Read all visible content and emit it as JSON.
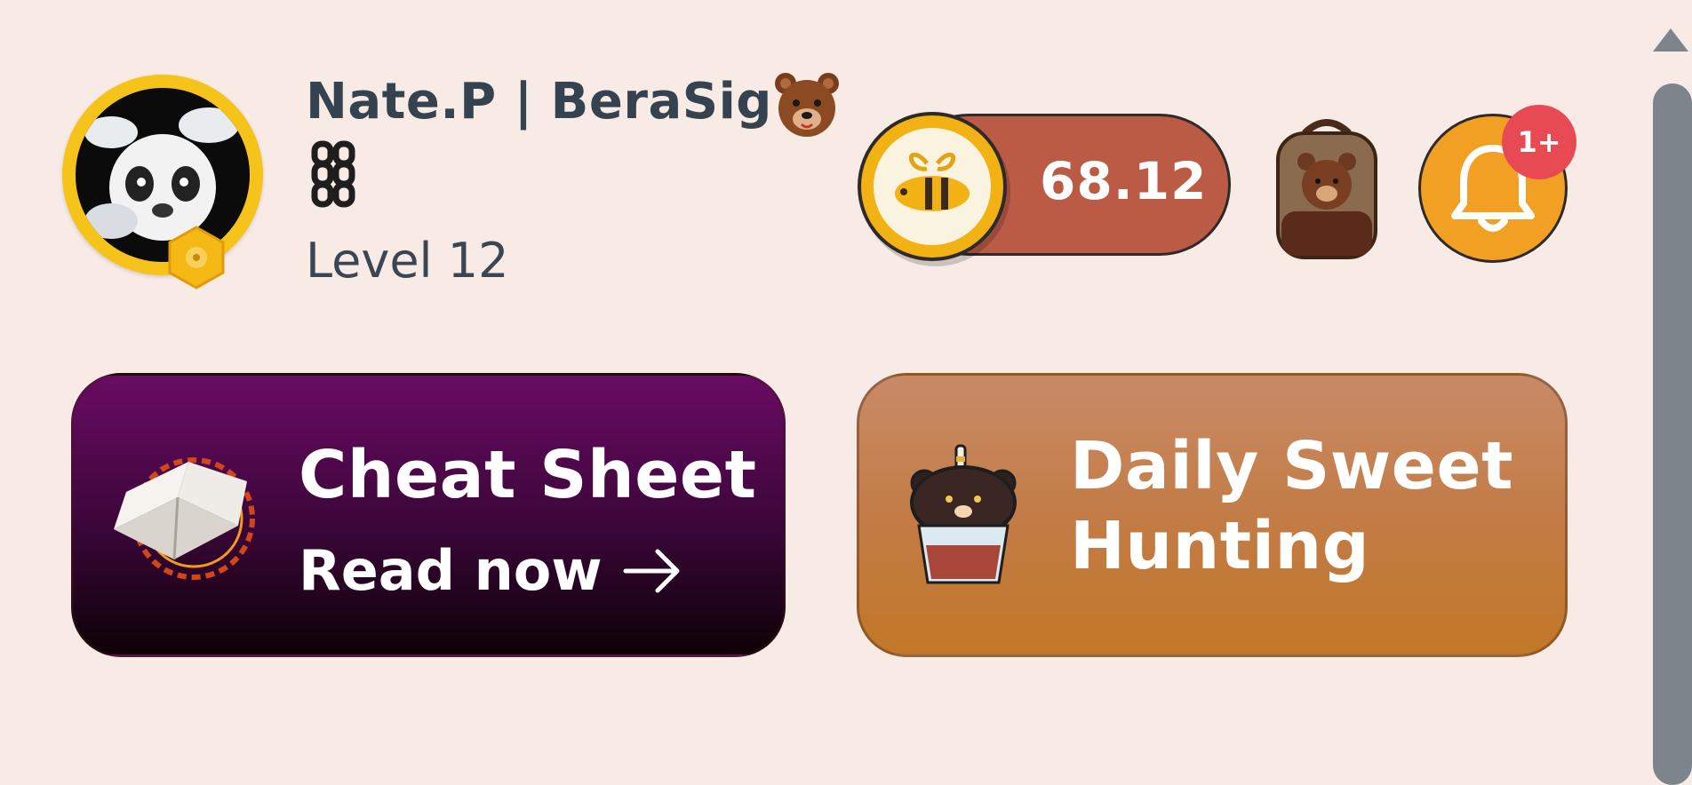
{
  "profile": {
    "username": "Nate.P | BeraSig",
    "level": "Level 12"
  },
  "balance": {
    "value": "68.12"
  },
  "notifications": {
    "badge": "1+"
  },
  "cards": {
    "cheat_sheet": {
      "title": "Cheat Sheet",
      "cta": "Read now"
    },
    "daily": {
      "title": "Daily Sweet Hunting"
    }
  },
  "icons": {
    "bear": "bear-emoji-icon",
    "chain": "chain-icon",
    "coin": "honey-coin-icon",
    "backpack": "bear-backpack-icon",
    "bell": "bell-icon",
    "book": "book-icon",
    "cupcake": "bear-cupcake-icon",
    "arrow": "arrow-right-icon"
  },
  "colors": {
    "background": "#f8ebe6",
    "balance_pill": "#bb5b45",
    "coin": "#f2b214",
    "bell": "#f2a023",
    "badge": "#e74a52",
    "cheat_card_top": "#6a0b63",
    "cheat_card_bottom": "#0d0206",
    "daily_card": "#c37b44"
  }
}
